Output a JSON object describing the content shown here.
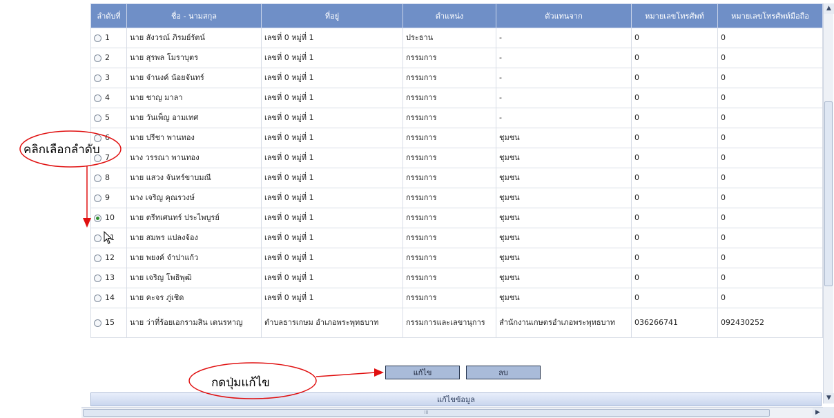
{
  "table": {
    "headers": [
      "ลำดับที่",
      "ชื่อ - นามสกุล",
      "ที่อยู่",
      "ตำแหน่ง",
      "ตัวแทนจาก",
      "หมายเลขโทรศัพท์",
      "หมายเลขโทรศัพท์มือถือ"
    ],
    "rows": [
      {
        "seq": "1",
        "name": "นาย สังวรณ์ ภิรมย์รัตน์",
        "address": "เลขที่ 0 หมู่ที่ 1",
        "position": "ประธาน",
        "from": "-",
        "phone": "0",
        "mobile": "0"
      },
      {
        "seq": "2",
        "name": "นาย สุรพล โมราบุตร",
        "address": "เลขที่ 0 หมู่ที่ 1",
        "position": "กรรมการ",
        "from": "-",
        "phone": "0",
        "mobile": "0"
      },
      {
        "seq": "3",
        "name": "นาย จำนงค์ น้อยจันทร์",
        "address": "เลขที่ 0 หมู่ที่ 1",
        "position": "กรรมการ",
        "from": "-",
        "phone": "0",
        "mobile": "0"
      },
      {
        "seq": "4",
        "name": "นาย ชาญ มาลา",
        "address": "เลขที่ 0 หมู่ที่ 1",
        "position": "กรรมการ",
        "from": "-",
        "phone": "0",
        "mobile": "0"
      },
      {
        "seq": "5",
        "name": "นาย วันเพ็ญ อามเทศ",
        "address": "เลขที่ 0 หมู่ที่ 1",
        "position": "กรรมการ",
        "from": "-",
        "phone": "0",
        "mobile": "0"
      },
      {
        "seq": "6",
        "name": "นาย ปรีชา พานทอง",
        "address": "เลขที่ 0 หมู่ที่ 1",
        "position": "กรรมการ",
        "from": "ชุมชน",
        "phone": "0",
        "mobile": "0"
      },
      {
        "seq": "7",
        "name": "นาง วรรณา พานทอง",
        "address": "เลขที่ 0 หมู่ที่ 1",
        "position": "กรรมการ",
        "from": "ชุมชน",
        "phone": "0",
        "mobile": "0"
      },
      {
        "seq": "8",
        "name": "นาย แสวง จันทร์ขาบมณี",
        "address": "เลขที่ 0 หมู่ที่ 1",
        "position": "กรรมการ",
        "from": "ชุมชน",
        "phone": "0",
        "mobile": "0"
      },
      {
        "seq": "9",
        "name": "นาง เจริญ คุณรวงษ์",
        "address": "เลขที่ 0 หมู่ที่ 1",
        "position": "กรรมการ",
        "from": "ชุมชน",
        "phone": "0",
        "mobile": "0"
      },
      {
        "seq": "10",
        "name": "นาย ตรีทเศนทร์ ประไพบูรย์",
        "address": "เลขที่ 0 หมู่ที่ 1",
        "position": "กรรมการ",
        "from": "ชุมชน",
        "phone": "0",
        "mobile": "0",
        "selected": true
      },
      {
        "seq": "11",
        "name": "นาย สมพร แปลงจ้อง",
        "address": "เลขที่ 0 หมู่ที่ 1",
        "position": "กรรมการ",
        "from": "ชุมชน",
        "phone": "0",
        "mobile": "0"
      },
      {
        "seq": "12",
        "name": "นาย พยงค์ จำปาแก้ว",
        "address": "เลขที่ 0 หมู่ที่ 1",
        "position": "กรรมการ",
        "from": "ชุมชน",
        "phone": "0",
        "mobile": "0"
      },
      {
        "seq": "13",
        "name": "นาย เจริญ โพธิพุฒิ",
        "address": "เลขที่ 0 หมู่ที่ 1",
        "position": "กรรมการ",
        "from": "ชุมชน",
        "phone": "0",
        "mobile": "0"
      },
      {
        "seq": "14",
        "name": "นาย คะจร ภู่เชิด",
        "address": "เลขที่ 0 หมู่ที่ 1",
        "position": "กรรมการ",
        "from": "ชุมชน",
        "phone": "0",
        "mobile": "0"
      },
      {
        "seq": "15",
        "name": "นาย ว่าที่ร้อยเอกรามสิน เตนรหาญ",
        "address": "ตำบลธารเกษม อำเภอพระพุทธบาท",
        "position": "กรรมการและเลขานุการ",
        "from": "สำนักงานเกษตรอำเภอพระพุทธบาท",
        "phone": "036266741",
        "mobile": "092430252"
      }
    ]
  },
  "buttons": {
    "edit": "แก้ไข",
    "delete": "ลบ"
  },
  "bottom_bar": {
    "label": "แก้ไขข้อมูล"
  },
  "annotations": {
    "select_row": "คลิกเลือกลำดับ",
    "press_edit": "กดปุ่มแก้ไข"
  },
  "colors": {
    "header_bg": "#6f8fc7",
    "annotation_red": "#e01010",
    "selected_radio": "#2f8f2f"
  }
}
